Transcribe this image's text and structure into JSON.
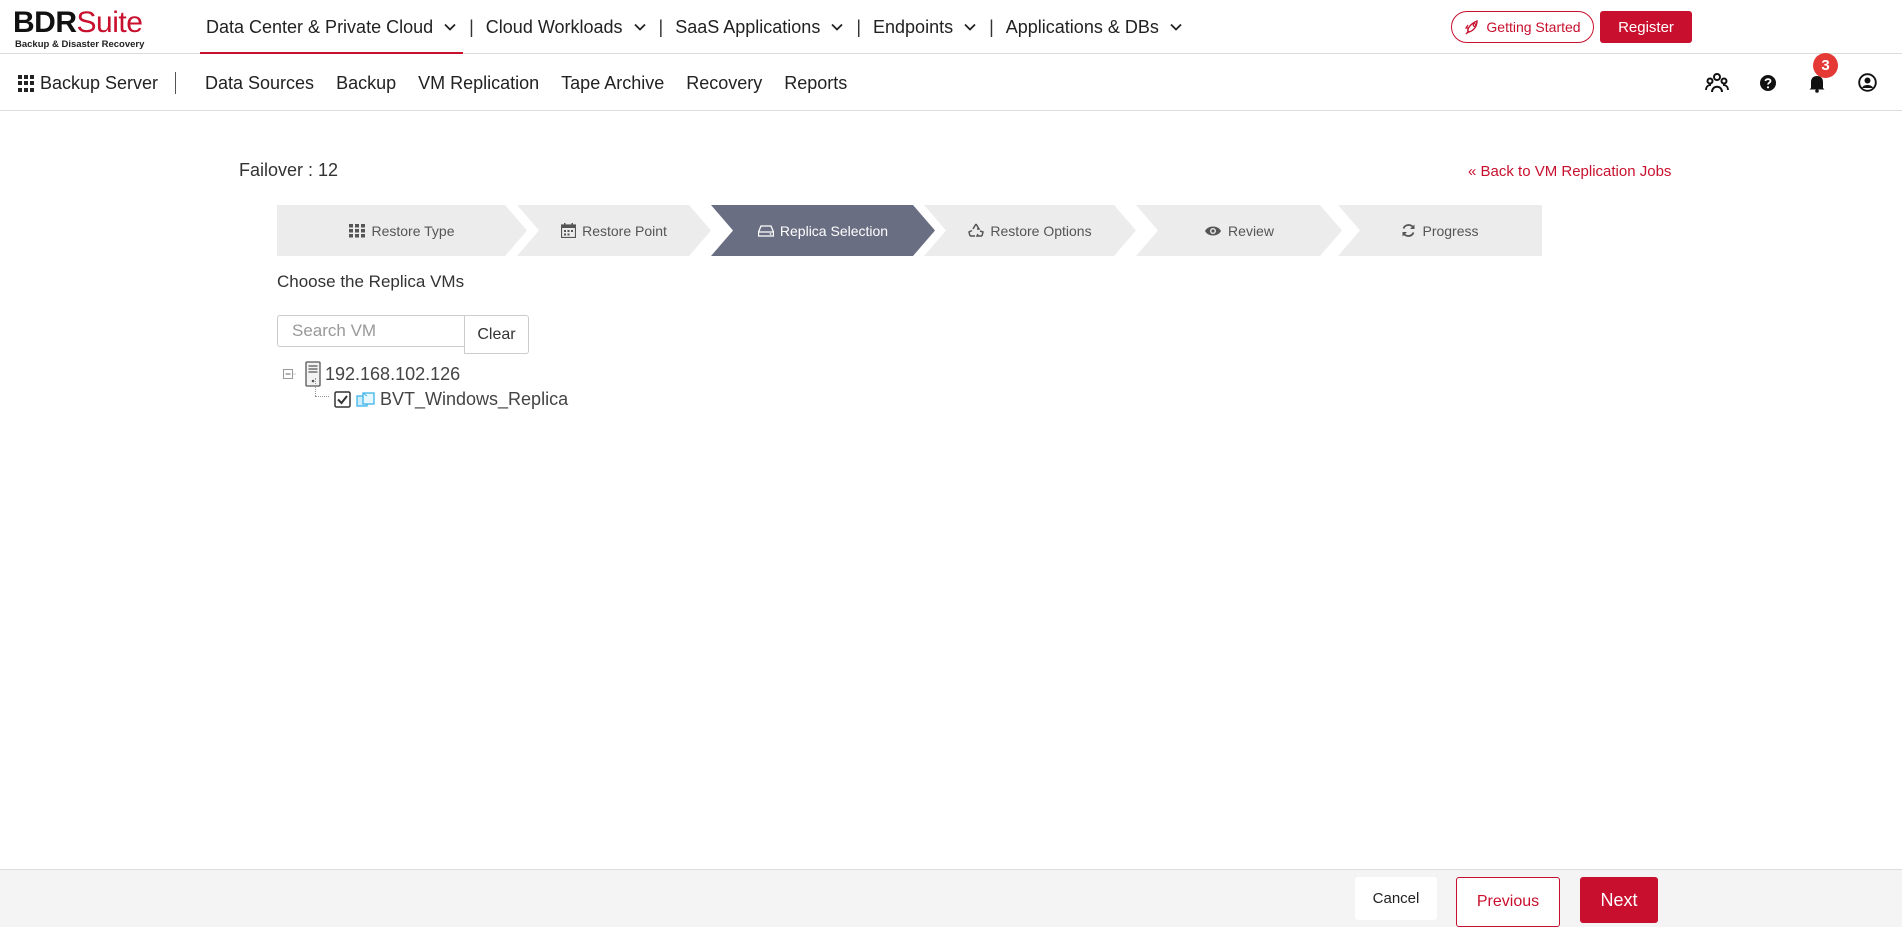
{
  "brand": {
    "name_black": "BDR",
    "name_red": "Suite",
    "tagline": "Backup & Disaster Recovery",
    "accent_color": "#c8102e"
  },
  "top_nav": {
    "items": [
      {
        "label": "Data Center & Private Cloud",
        "active": true
      },
      {
        "label": "Cloud Workloads"
      },
      {
        "label": "SaaS Applications"
      },
      {
        "label": "Endpoints"
      },
      {
        "label": "Applications & DBs"
      }
    ],
    "separator": "|"
  },
  "sub_nav": {
    "app_label": "Backup Server",
    "items": [
      "Data Sources",
      "Backup",
      "VM Replication",
      "Tape Archive",
      "Recovery",
      "Reports"
    ],
    "getting_started": "Getting Started",
    "register": "Register",
    "notification_count": "3"
  },
  "page": {
    "title": "Failover : 12",
    "back_link": "« Back to VM Replication Jobs",
    "instruction": "Choose the Replica VMs"
  },
  "wizard": {
    "steps": [
      {
        "label": "Restore Type",
        "icon": "grid-icon"
      },
      {
        "label": "Restore Point",
        "icon": "calendar-icon"
      },
      {
        "label": "Replica Selection",
        "icon": "hdd-icon",
        "active": true
      },
      {
        "label": "Restore Options",
        "icon": "recycle-icon"
      },
      {
        "label": "Review",
        "icon": "eye-icon"
      },
      {
        "label": "Progress",
        "icon": "refresh-icon"
      }
    ]
  },
  "search": {
    "placeholder": "Search VM",
    "clear_label": "Clear"
  },
  "tree": {
    "host": "192.168.102.126",
    "vm": "BVT_Windows_Replica",
    "vm_checked": true
  },
  "footer": {
    "cancel": "Cancel",
    "previous": "Previous",
    "next": "Next"
  }
}
